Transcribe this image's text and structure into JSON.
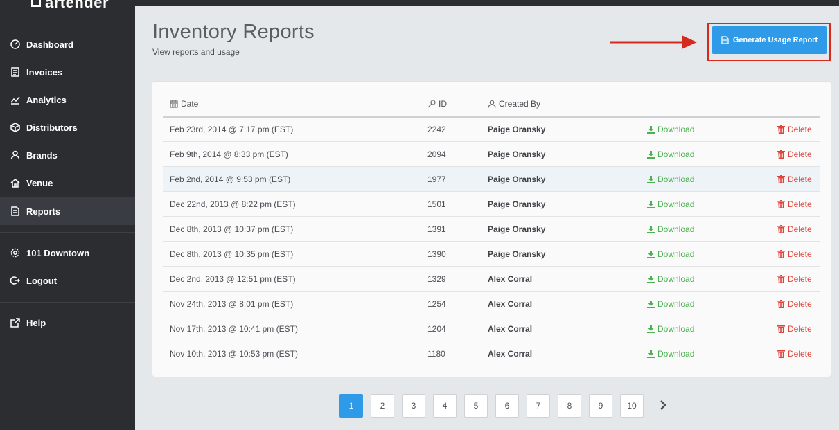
{
  "app": {
    "logo_text": "artender"
  },
  "sidebar": {
    "items": [
      {
        "label": "Dashboard",
        "icon": "dashboard-icon"
      },
      {
        "label": "Invoices",
        "icon": "invoice-icon"
      },
      {
        "label": "Analytics",
        "icon": "analytics-icon"
      },
      {
        "label": "Distributors",
        "icon": "box-icon"
      },
      {
        "label": "Brands",
        "icon": "user-icon"
      },
      {
        "label": "Venue",
        "icon": "home-icon"
      },
      {
        "label": "Reports",
        "icon": "report-icon",
        "active": true
      }
    ],
    "venue": {
      "label": "101 Downtown",
      "icon": "gear-icon"
    },
    "logout": {
      "label": "Logout",
      "icon": "logout-icon"
    },
    "help": {
      "label": "Help",
      "icon": "external-link-icon"
    }
  },
  "header": {
    "title": "Inventory Reports",
    "subtitle": "View reports and usage",
    "generate_button": "Generate Usage Report"
  },
  "table": {
    "columns": {
      "date": "Date",
      "id": "ID",
      "created_by": "Created By"
    },
    "download_label": "Download",
    "delete_label": "Delete",
    "rows": [
      {
        "date": "Feb 23rd, 2014 @ 7:17 pm (EST)",
        "id": "2242",
        "created_by": "Paige Oransky"
      },
      {
        "date": "Feb 9th, 2014 @ 8:33 pm (EST)",
        "id": "2094",
        "created_by": "Paige Oransky"
      },
      {
        "date": "Feb 2nd, 2014 @ 9:53 pm (EST)",
        "id": "1977",
        "created_by": "Paige Oransky"
      },
      {
        "date": "Dec 22nd, 2013 @ 8:22 pm (EST)",
        "id": "1501",
        "created_by": "Paige Oransky"
      },
      {
        "date": "Dec 8th, 2013 @ 10:37 pm (EST)",
        "id": "1391",
        "created_by": "Paige Oransky"
      },
      {
        "date": "Dec 8th, 2013 @ 10:35 pm (EST)",
        "id": "1390",
        "created_by": "Paige Oransky"
      },
      {
        "date": "Dec 2nd, 2013 @ 12:51 pm (EST)",
        "id": "1329",
        "created_by": "Alex Corral"
      },
      {
        "date": "Nov 24th, 2013 @ 8:01 pm (EST)",
        "id": "1254",
        "created_by": "Alex Corral"
      },
      {
        "date": "Nov 17th, 2013 @ 10:41 pm (EST)",
        "id": "1204",
        "created_by": "Alex Corral"
      },
      {
        "date": "Nov 10th, 2013 @ 10:53 pm (EST)",
        "id": "1180",
        "created_by": "Alex Corral"
      }
    ]
  },
  "pagination": {
    "pages": [
      "1",
      "2",
      "3",
      "4",
      "5",
      "6",
      "7",
      "8",
      "9",
      "10"
    ],
    "current": "1"
  },
  "colors": {
    "sidebar_bg": "#2b2d31",
    "accent": "#2f9be8",
    "download": "#4db051",
    "delete": "#e0443a",
    "highlight_outline": "#d62a1e"
  }
}
